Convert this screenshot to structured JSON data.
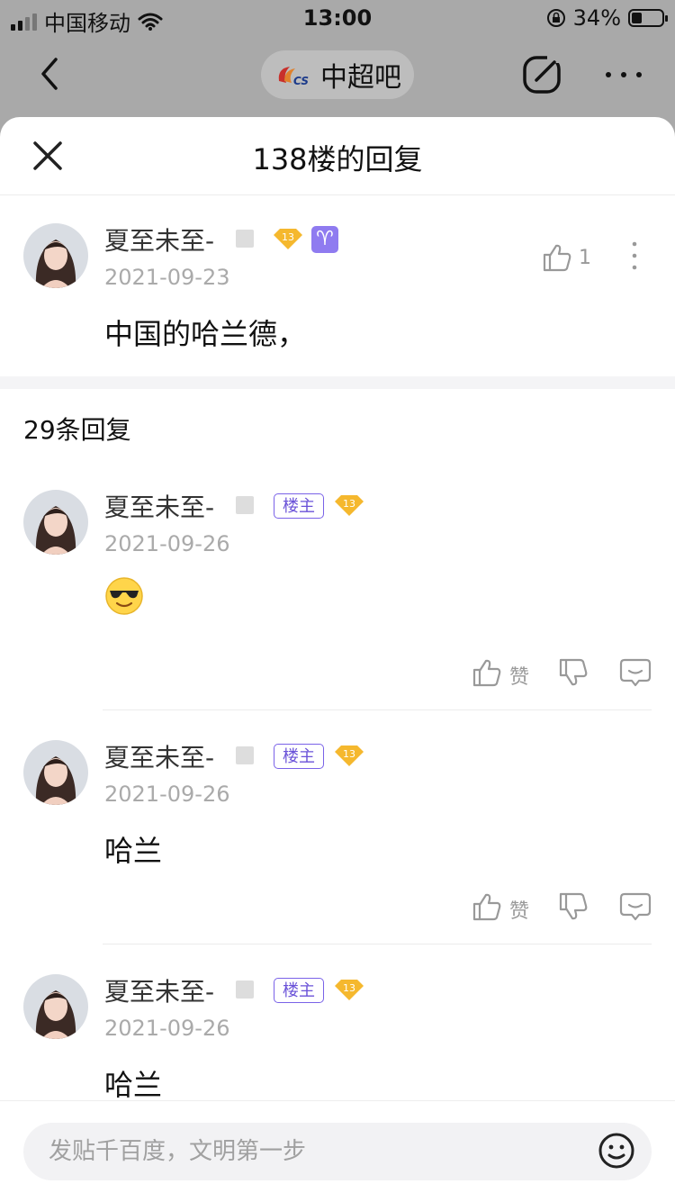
{
  "status_bar": {
    "carrier": "中国移动",
    "time": "13:00",
    "battery": "34%",
    "battery_level": 0.34
  },
  "nav": {
    "forum_name": "中超吧",
    "forum_logo_text": "CS"
  },
  "sheet": {
    "title": "138楼的回复"
  },
  "main_post": {
    "username": "夏至未至-",
    "level": "13",
    "zodiac": "♈",
    "date": "2021-09-23",
    "content": "中国的哈兰德，",
    "like_count": "1"
  },
  "replies_count": "29条回复",
  "replies": [
    {
      "username": "夏至未至-",
      "badge": "楼主",
      "level": "13",
      "date": "2021-09-26",
      "content": "",
      "emoji": "cool-sunglasses",
      "like_label": "赞"
    },
    {
      "username": "夏至未至-",
      "badge": "楼主",
      "level": "13",
      "date": "2021-09-26",
      "content": "哈兰",
      "like_label": "赞"
    },
    {
      "username": "夏至未至-",
      "badge": "楼主",
      "level": "13",
      "date": "2021-09-26",
      "content": "哈兰"
    }
  ],
  "composer": {
    "placeholder": "发贴千百度，文明第一步"
  },
  "colors": {
    "accent": "#7a62e8",
    "gem": "#f5b82e",
    "overlay": "#a9a9a9"
  }
}
